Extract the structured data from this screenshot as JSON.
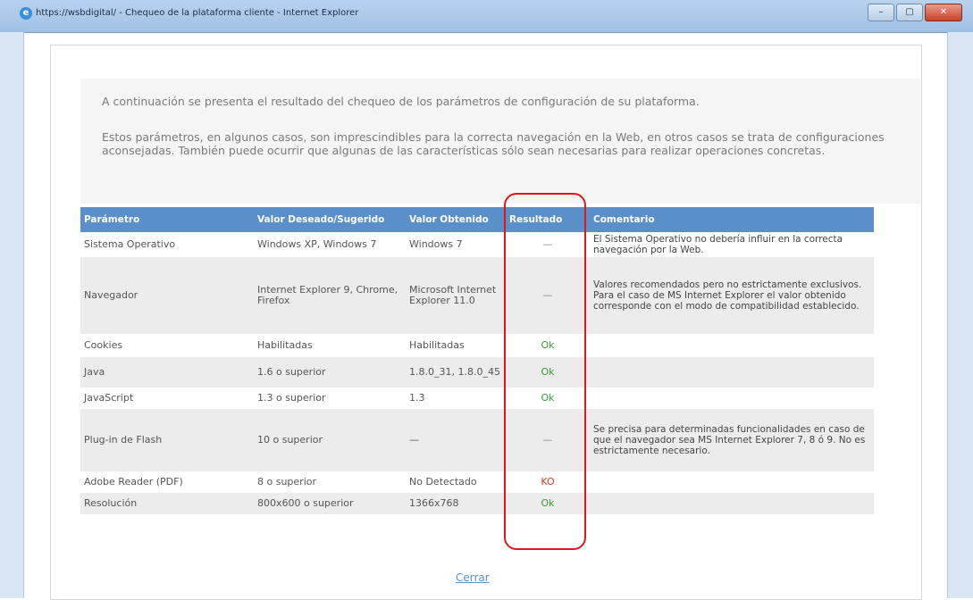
{
  "window": {
    "title": "https://wsbdigital/ - Chequeo de la plataforma cliente - Internet Explorer",
    "buttons": [
      "–",
      "▢",
      "✕"
    ]
  },
  "intro": {
    "p1": "A continuación se presenta el resultado del chequeo de los parámetros de configuración de su plataforma.",
    "p2": "Estos parámetros, en algunos casos, son imprescindibles para la correcta navegación en la Web, en otros casos se trata de configuraciones aconsejadas. También puede ocurrir que algunas de las características sólo sean necesarias para realizar operaciones concretas."
  },
  "table": {
    "headers": [
      "Parámetro",
      "Valor Deseado/Sugerido",
      "Valor Obtenido",
      "Resultado",
      "Comentario"
    ],
    "rows": [
      {
        "param": "Sistema Operativo",
        "deseado": "Windows XP, Windows 7",
        "obtenido": "Windows 7",
        "resultado": "—",
        "status": "neutral",
        "comentario": "El Sistema Operativo no debería influir en la correcta navegación por la Web."
      },
      {
        "param": "Navegador",
        "deseado": "Internet Explorer 9, Chrome, Firefox",
        "obtenido": "Microsoft Internet Explorer 11.0",
        "resultado": "—",
        "status": "neutral",
        "comentario": "Valores recomendados pero no estrictamente exclusivos. Para el caso de MS Internet Explorer el valor obtenido corresponde con el modo de compatibilidad establecido."
      },
      {
        "param": "Cookies",
        "deseado": "Habilitadas",
        "obtenido": "Habilitadas",
        "resultado": "Ok",
        "status": "ok",
        "comentario": ""
      },
      {
        "param": "Java",
        "deseado": "1.6 o superior",
        "obtenido": "1.8.0_31, 1.8.0_45",
        "resultado": "Ok",
        "status": "ok",
        "comentario": ""
      },
      {
        "param": "JavaScript",
        "deseado": "1.3 o superior",
        "obtenido": "1.3",
        "resultado": "Ok",
        "status": "ok",
        "comentario": ""
      },
      {
        "param": "Plug-in de Flash",
        "deseado": "10 o superior",
        "obtenido": "—",
        "resultado": "—",
        "status": "neutral",
        "comentario": "Se precisa para determinadas funcionalidades en caso de que el navegador sea MS Internet Explorer 7, 8 ó 9. No es estrictamente necesario."
      },
      {
        "param": "Adobe Reader (PDF)",
        "deseado": "8 o superior",
        "obtenido": "No Detectado",
        "resultado": "KO",
        "status": "ko",
        "comentario": ""
      },
      {
        "param": "Resolución",
        "deseado": "800x600 o superior",
        "obtenido": "1366x768",
        "resultado": "Ok",
        "status": "ok",
        "comentario": ""
      }
    ]
  },
  "footer": {
    "close_label": "Cerrar"
  },
  "colors": {
    "header_bg": "#5b8fca",
    "ok": "#3a9a3a",
    "ko": "#d43a2a",
    "highlight": "#e01818"
  }
}
